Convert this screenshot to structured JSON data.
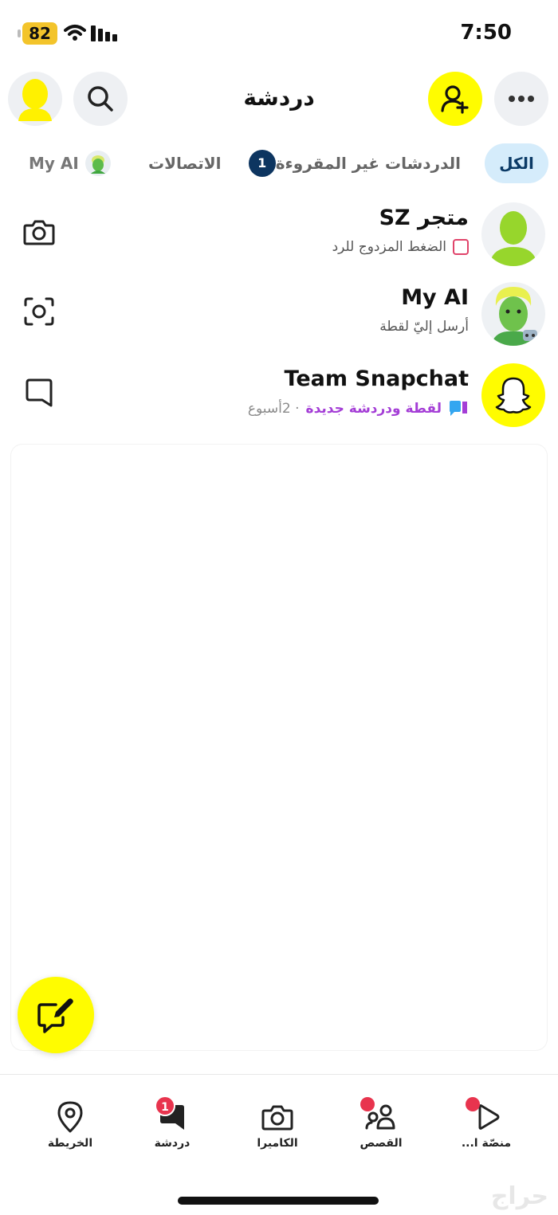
{
  "status_bar": {
    "battery": "82",
    "time": "7:50"
  },
  "header": {
    "title": "دردشة"
  },
  "tabs": {
    "all": "الكل",
    "unread": "الدردشات غير المقروءة",
    "unread_count": "1",
    "contacts": "الاتصالات",
    "my_ai": "My AI"
  },
  "chats": [
    {
      "name": "متجر SZ",
      "subtitle": "الضغط المزدوج للرد"
    },
    {
      "name": "My AI",
      "subtitle": "أرسل إليّ لقطة"
    },
    {
      "name": "Team Snapchat",
      "subtitle_status": "لقطة ودردشة جديدة",
      "subtitle_time": "· 2أسبوع"
    }
  ],
  "bottom_nav": {
    "map": "الخريطة",
    "chat": "دردشة",
    "chat_badge": "1",
    "camera": "الكاميرا",
    "stories": "القصص",
    "spotlight": "منصّة ا..."
  },
  "watermark": "حراج",
  "colors": {
    "snap_yellow": "#fffc00",
    "badge_red": "#e8344e",
    "unread_navy": "#0d3560",
    "accent_purple": "#a43ed6"
  },
  "icons": [
    "wifi-icon",
    "signal-icon",
    "search-icon",
    "add-friend-icon",
    "more-icon",
    "camera-icon",
    "scan-icon",
    "chat-bubble-icon",
    "new-chat-icon",
    "map-pin-icon",
    "stories-icon",
    "spotlight-icon",
    "ghost-icon"
  ]
}
